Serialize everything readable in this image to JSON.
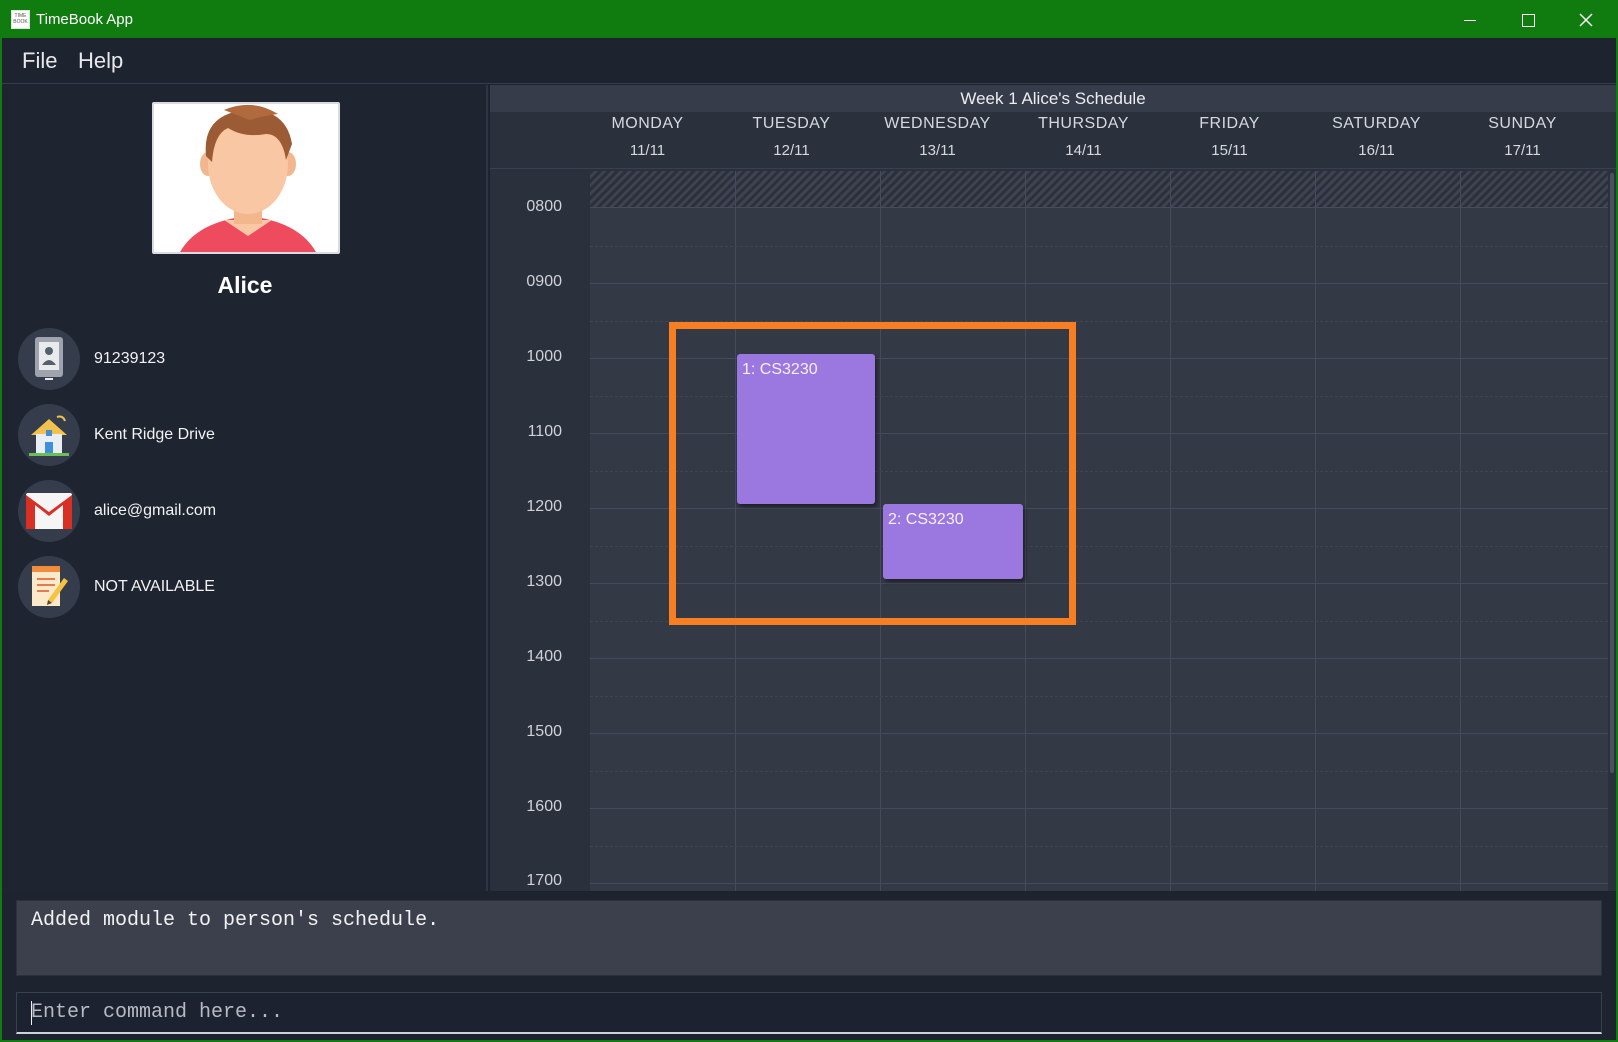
{
  "window": {
    "title": "TimeBook App",
    "icon_text": "TIME BOOK",
    "frame_color": "#107c10"
  },
  "menu": {
    "items": [
      {
        "label": "File"
      },
      {
        "label": "Help"
      }
    ]
  },
  "person": {
    "name": "Alice",
    "phone": "91239123",
    "address": "Kent Ridge Drive",
    "email": "alice@gmail.com",
    "remark": "NOT AVAILABLE",
    "icons": {
      "phone": "phone-icon",
      "address": "house-icon",
      "email": "gmail-icon",
      "remark": "notepad-icon"
    }
  },
  "schedule": {
    "title": "Week 1 Alice's Schedule",
    "days": [
      {
        "name": "MONDAY",
        "date": "11/11"
      },
      {
        "name": "TUESDAY",
        "date": "12/11"
      },
      {
        "name": "WEDNESDAY",
        "date": "13/11"
      },
      {
        "name": "THURSDAY",
        "date": "14/11"
      },
      {
        "name": "FRIDAY",
        "date": "15/11"
      },
      {
        "name": "SATURDAY",
        "date": "16/11"
      },
      {
        "name": "SUNDAY",
        "date": "17/11"
      }
    ],
    "times": [
      "0800",
      "0900",
      "1000",
      "1100",
      "1200",
      "1300",
      "1400",
      "1500",
      "1600",
      "1700"
    ],
    "modules": [
      {
        "label": "1: CS3230",
        "day": "TUESDAY",
        "start": "1000",
        "end": "1200"
      },
      {
        "label": "2: CS3230",
        "day": "WEDNESDAY",
        "start": "1200",
        "end": "1300"
      }
    ],
    "module_color": "#9b78e0",
    "highlight_color": "#f77f22"
  },
  "result": {
    "text": "Added module to person's schedule."
  },
  "command": {
    "placeholder": "Enter command here...",
    "value": ""
  }
}
